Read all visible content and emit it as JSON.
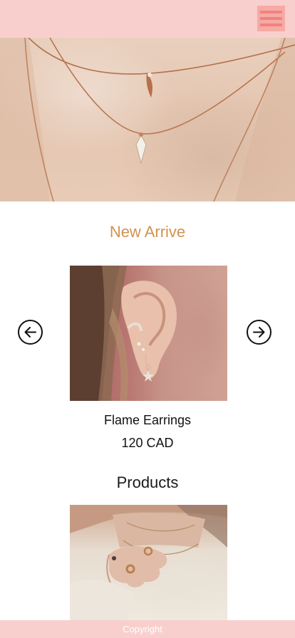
{
  "header": {
    "menu_icon": "hamburger-menu-icon"
  },
  "hero": {
    "image_subject": "necklace"
  },
  "new_arrive": {
    "title": "New Arrive",
    "prev_icon": "arrow-left-circle-icon",
    "next_icon": "arrow-right-circle-icon",
    "product": {
      "name": "Flame Earrings",
      "price": "120 CAD"
    }
  },
  "products": {
    "title": "Products"
  },
  "footer": {
    "text": "Copyright"
  },
  "colors": {
    "header_bg": "#f9cfcd",
    "menu_bg": "#f6aaa6",
    "menu_bars": "#f3827b",
    "accent_title": "#d0934f",
    "footer_bg": "#f9cfcd"
  }
}
